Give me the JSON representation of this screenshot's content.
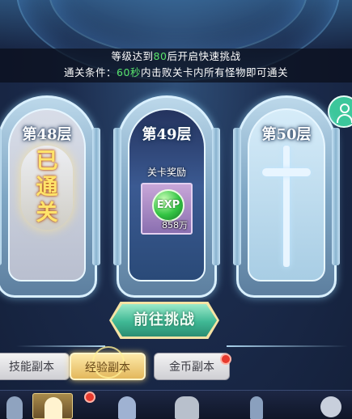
{
  "info": {
    "line1_prefix": "等级达到",
    "line1_level": "80",
    "line1_suffix": "后开启快速挑战",
    "line2_prefix": "通关条件：",
    "line2_time": "60秒",
    "line2_suffix": "内击败关卡内所有怪物即可通关"
  },
  "stages": [
    {
      "title": "第48层",
      "status_chars": [
        "已",
        "通",
        "关"
      ]
    },
    {
      "title": "第49层",
      "reward_label": "关卡奖励",
      "reward_icon_text": "EXP",
      "reward_amount": "858万"
    },
    {
      "title": "第50层"
    }
  ],
  "challenge_button": "前往挑战",
  "tabs": [
    {
      "label": "技能副本",
      "active": false,
      "badge": false
    },
    {
      "label": "经验副本",
      "active": true,
      "badge": false
    },
    {
      "label": "金币副本",
      "active": false,
      "badge": true
    }
  ],
  "bottom_nav": [
    "sword-icon",
    "hero-icon",
    "armor-icon",
    "party-icon",
    "weapon-icon",
    "settings-icon"
  ],
  "colors": {
    "highlight_green": "#58e36b",
    "button_green": "#3fb894",
    "tab_active_gold": "#e3b85c",
    "badge_red": "#e83a2e"
  }
}
